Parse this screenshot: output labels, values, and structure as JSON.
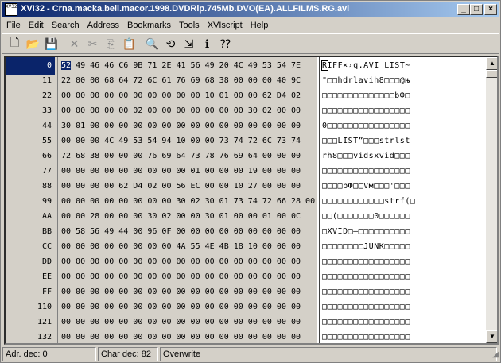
{
  "window": {
    "title": "XVI32 - Crna.macka.beli.macor.1998.DVDRip.745Mb.DVO(EA).ALLFILMS.RG.avi",
    "icon_text": "XV32"
  },
  "menu": [
    {
      "label": "File",
      "u": "F",
      "rest": "ile"
    },
    {
      "label": "Edit",
      "u": "E",
      "rest": "dit"
    },
    {
      "label": "Search",
      "u": "S",
      "rest": "earch"
    },
    {
      "label": "Address",
      "u": "A",
      "rest": "ddress"
    },
    {
      "label": "Bookmarks",
      "u": "B",
      "rest": "ookmarks"
    },
    {
      "label": "Tools",
      "u": "T",
      "rest": "ools"
    },
    {
      "label": "XVIscript",
      "u": "X",
      "rest": "VIscript"
    },
    {
      "label": "Help",
      "u": "H",
      "rest": "elp"
    }
  ],
  "toolbar": [
    {
      "name": "new-file-icon",
      "glyph": "🗋",
      "enabled": true
    },
    {
      "name": "open-folder-icon",
      "glyph": "📂",
      "enabled": true
    },
    {
      "name": "save-icon",
      "glyph": "💾",
      "enabled": true
    },
    {
      "name": "delete-icon",
      "glyph": "✕",
      "enabled": false
    },
    {
      "name": "cut-icon",
      "glyph": "✂",
      "enabled": false
    },
    {
      "name": "copy-icon",
      "glyph": "⎘",
      "enabled": false
    },
    {
      "name": "paste-icon",
      "glyph": "📋",
      "enabled": true
    },
    {
      "name": "find-icon",
      "glyph": "🔍",
      "enabled": true
    },
    {
      "name": "replace-icon",
      "glyph": "⟲",
      "enabled": true
    },
    {
      "name": "goto-icon",
      "glyph": "⇲",
      "enabled": true
    },
    {
      "name": "info-icon",
      "glyph": "ℹ",
      "enabled": true
    },
    {
      "name": "context-help-icon",
      "glyph": "⁇",
      "enabled": true
    }
  ],
  "rows": [
    {
      "addr": "0",
      "hex": "52 49 46 46 C6 9B 71 2E 41 56 49 20 4C 49 53 54 7E",
      "chars": "RIFF×›q.AVI LIST~"
    },
    {
      "addr": "11",
      "hex": "22 00 00 68 64 72 6C 61 76 69 68 38 00 00 00 40 9C",
      "chars": "\"□□hdrlavih8□□□@њ"
    },
    {
      "addr": "22",
      "hex": "00 00 00 00 00 00 00 00 00 00 10 01 00 00 62 D4 02",
      "chars": "□□□□□□□□□□□□□□bФ□"
    },
    {
      "addr": "33",
      "hex": "00 00 00 00 00 02 00 00 00 00 00 00 00 30 02 00 00",
      "chars": "□□□□□□□□□□□□□□□□□"
    },
    {
      "addr": "44",
      "hex": "30 01 00 00 00 00 00 00 00 00 00 00 00 00 00 00 00",
      "chars": "0□□□□□□□□□□□□□□□□"
    },
    {
      "addr": "55",
      "hex": "00 00 00 4C 49 53 54 94 10 00 00 73 74 72 6C 73 74",
      "chars": "□□□LIST”□□□strlst"
    },
    {
      "addr": "66",
      "hex": "72 68 38 00 00 00 76 69 64 73 78 76 69 64 00 00 00",
      "chars": "rh8□□□vidsxvid□□□"
    },
    {
      "addr": "77",
      "hex": "00 00 00 00 00 00 00 00 00 01 00 00 00 19 00 00 00",
      "chars": "□□□□□□□□□□□□□□□□□"
    },
    {
      "addr": "88",
      "hex": "00 00 00 00 62 D4 02 00 56 EC 00 00 10 27 00 00 00",
      "chars": "□□□□bФ□□Vм□□□'□□□"
    },
    {
      "addr": "99",
      "hex": "00 00 00 00 00 00 00 00 30 02 30 01 73 74 72 66 28 00",
      "chars": "□□□□□□□□□□□□strf(□"
    },
    {
      "addr": "AA",
      "hex": "00 00 28 00 00 00 30 02 00 00 30 01 00 00 01 00 0C",
      "chars": "□□(□□□□□□□0□□□□□□"
    },
    {
      "addr": "BB",
      "hex": "00 58 56 49 44 00 96 0F 00 00 00 00 00 00 00 00 00",
      "chars": "□XVID□–□□□□□□□□□□"
    },
    {
      "addr": "CC",
      "hex": "00 00 00 00 00 00 00 00 4A 55 4E 4B 18 10 00 00 00",
      "chars": "□□□□□□□□JUNK□□□□□"
    },
    {
      "addr": "DD",
      "hex": "00 00 00 00 00 00 00 00 00 00 00 00 00 00 00 00 00",
      "chars": "□□□□□□□□□□□□□□□□□"
    },
    {
      "addr": "EE",
      "hex": "00 00 00 00 00 00 00 00 00 00 00 00 00 00 00 00 00",
      "chars": "□□□□□□□□□□□□□□□□□"
    },
    {
      "addr": "FF",
      "hex": "00 00 00 00 00 00 00 00 00 00 00 00 00 00 00 00 00",
      "chars": "□□□□□□□□□□□□□□□□□"
    },
    {
      "addr": "110",
      "hex": "00 00 00 00 00 00 00 00 00 00 00 00 00 00 00 00 00",
      "chars": "□□□□□□□□□□□□□□□□□"
    },
    {
      "addr": "121",
      "hex": "00 00 00 00 00 00 00 00 00 00 00 00 00 00 00 00 00",
      "chars": "□□□□□□□□□□□□□□□□□"
    },
    {
      "addr": "132",
      "hex": "00 00 00 00 00 00 00 00 00 00 00 00 00 00 00 00 00",
      "chars": "□□□□□□□□□□□□□□□□□"
    }
  ],
  "status": {
    "addr": "Adr. dec: 0",
    "char": "Char dec: 82",
    "mode": "Overwrite"
  },
  "colors": {
    "selection": "#0a246a",
    "face": "#d4d0c8"
  }
}
